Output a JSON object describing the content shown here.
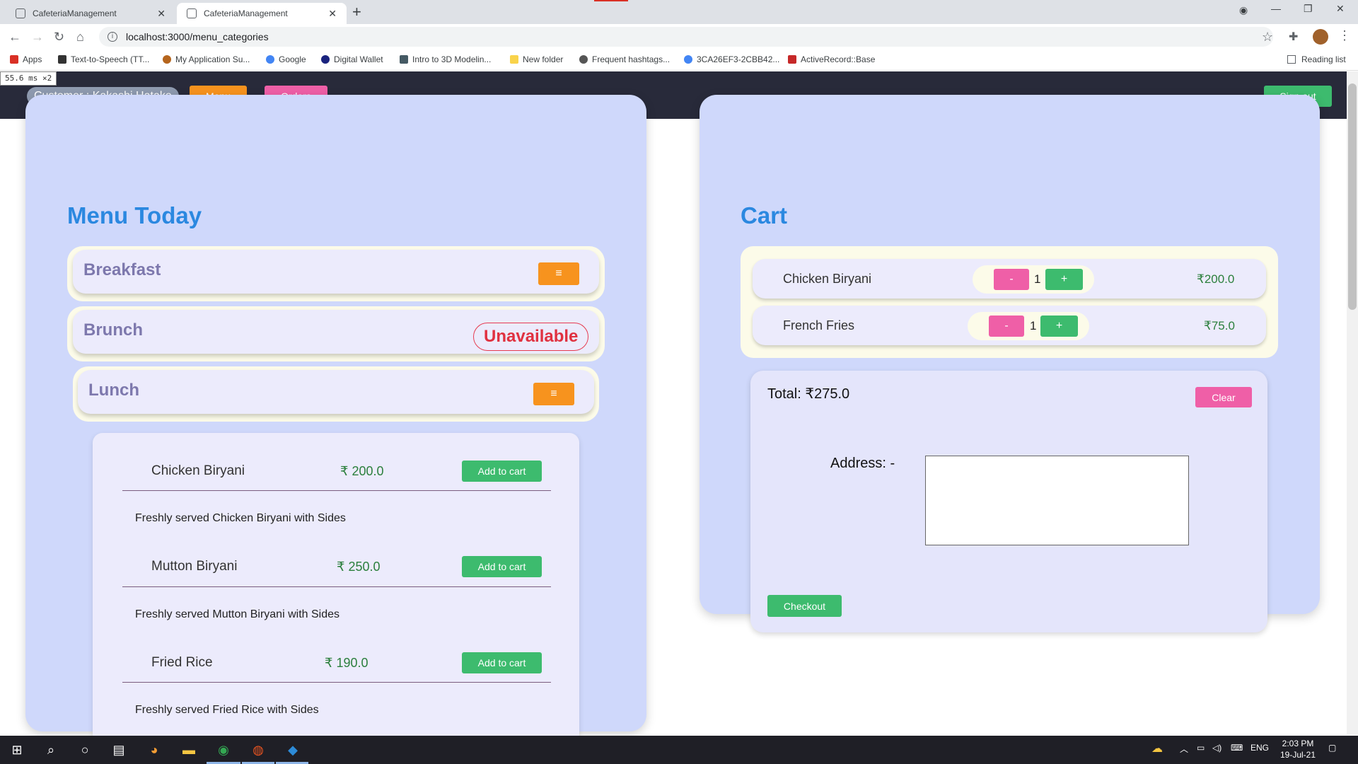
{
  "browser": {
    "tabs": [
      {
        "title": "CafeteriaManagement",
        "close": "✕"
      },
      {
        "title": "CafeteriaManagement",
        "close": "✕"
      }
    ],
    "new_tab": "+",
    "url": "localhost:3000/menu_categories",
    "bookmarks": [
      {
        "label": "Apps",
        "icon": "apps-grid-icon",
        "color": "#d93025"
      },
      {
        "label": "Text-to-Speech (TT...",
        "icon": "tts-icon",
        "color": "#333333"
      },
      {
        "label": "My Application Su...",
        "icon": "application-icon",
        "color": "#b5651d"
      },
      {
        "label": "Google",
        "icon": "google-icon",
        "color": "#4285f4"
      },
      {
        "label": "Digital Wallet",
        "icon": "wallet-icon",
        "color": "#1a237e"
      },
      {
        "label": "Intro to 3D Modelin...",
        "icon": "modeling-icon",
        "color": "#455a64"
      },
      {
        "label": "New folder",
        "icon": "folder-icon",
        "color": "#f9d34b"
      },
      {
        "label": "Frequent hashtags...",
        "icon": "hashtag-icon",
        "color": "#555555"
      },
      {
        "label": "3CA26EF3-2CBB42...",
        "icon": "google-icon",
        "color": "#4285f4"
      },
      {
        "label": "ActiveRecord::Base",
        "icon": "rails-icon",
        "color": "#c62828"
      }
    ],
    "reading_list": "Reading list"
  },
  "perf_badge": "55.6 ms ×2",
  "navbar": {
    "customer_label": "Customer : Kakashi Hatake",
    "menu_label": "Menu",
    "orders_label": "Orders",
    "signout_label": "Sign out"
  },
  "menu": {
    "title": "Menu Today",
    "categories": [
      {
        "name": "Breakfast",
        "action": "≡"
      },
      {
        "name": "Brunch",
        "status": "Unavailable"
      },
      {
        "name": "Lunch",
        "action": "≡"
      }
    ],
    "items": [
      {
        "name": "Chicken Biryani",
        "price": "₹ 200.0",
        "button": "Add to cart",
        "description": "Freshly served Chicken Biryani with Sides"
      },
      {
        "name": "Mutton Biryani",
        "price": "₹ 250.0",
        "button": "Add to cart",
        "description": "Freshly served Mutton Biryani with Sides"
      },
      {
        "name": "Fried Rice",
        "price": "₹ 190.0",
        "button": "Add to cart",
        "description": "Freshly served Fried Rice with Sides"
      }
    ]
  },
  "cart": {
    "title": "Cart",
    "items": [
      {
        "name": "Chicken Biryani",
        "qty": "1",
        "price": "₹200.0",
        "minus": "-",
        "plus": "+"
      },
      {
        "name": "French Fries",
        "qty": "1",
        "price": "₹75.0",
        "minus": "-",
        "plus": "+"
      }
    ],
    "total": "Total: ₹275.0",
    "clear_label": "Clear",
    "address_label": "Address: -",
    "address_value": "",
    "checkout_label": "Checkout"
  },
  "taskbar": {
    "language": "ENG",
    "time": "2:03 PM",
    "date": "19-Jul-21"
  },
  "colors": {
    "navbar": "#282a3a",
    "panel": "#cfd8fb",
    "title_blue": "#2b88e0",
    "orange": "#f7931e",
    "pink": "#ef5fa7",
    "green": "#3dbb6e",
    "unavailable_red": "#e03140"
  }
}
